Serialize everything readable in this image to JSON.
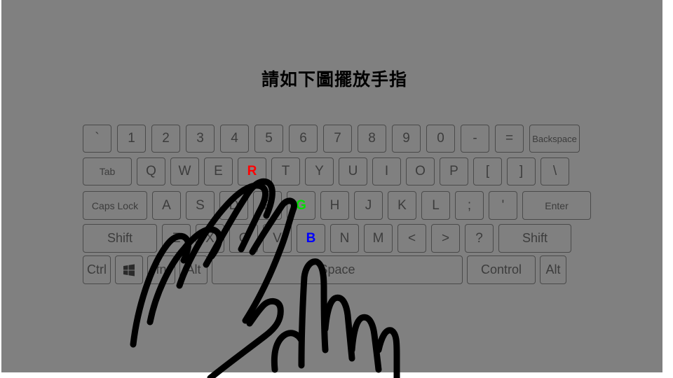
{
  "instruction": "請如下圖擺放手指",
  "keyboard": {
    "row1": [
      "`",
      "1",
      "2",
      "3",
      "4",
      "5",
      "6",
      "7",
      "8",
      "9",
      "0",
      "-",
      "=",
      "Backspace"
    ],
    "row2": [
      "Tab",
      "Q",
      "W",
      "E",
      "R",
      "T",
      "Y",
      "U",
      "I",
      "O",
      "P",
      "[",
      "]",
      "\\"
    ],
    "row3": [
      "Caps Lock",
      "A",
      "S",
      "D",
      "F",
      "G",
      "H",
      "J",
      "K",
      "L",
      ";",
      "'",
      "Enter"
    ],
    "row4": [
      "Shift",
      "Z",
      "X",
      "C",
      "V",
      "B",
      "N",
      "M",
      "<",
      ">",
      "?",
      "Shift"
    ],
    "row5": [
      "Ctrl",
      "windows-icon",
      "fn",
      "Alt",
      "Space",
      "Control",
      "Alt"
    ]
  },
  "highlighted_keys": [
    {
      "key": "R",
      "color": "#ff0000"
    },
    {
      "key": "G",
      "color": "#00dd00"
    },
    {
      "key": "B",
      "color": "#0000ff"
    }
  ],
  "colors": {
    "background": "#808080",
    "key_border": "#4a4a4a",
    "key_text": "#3c3c3c",
    "hand_outline": "#000000"
  }
}
